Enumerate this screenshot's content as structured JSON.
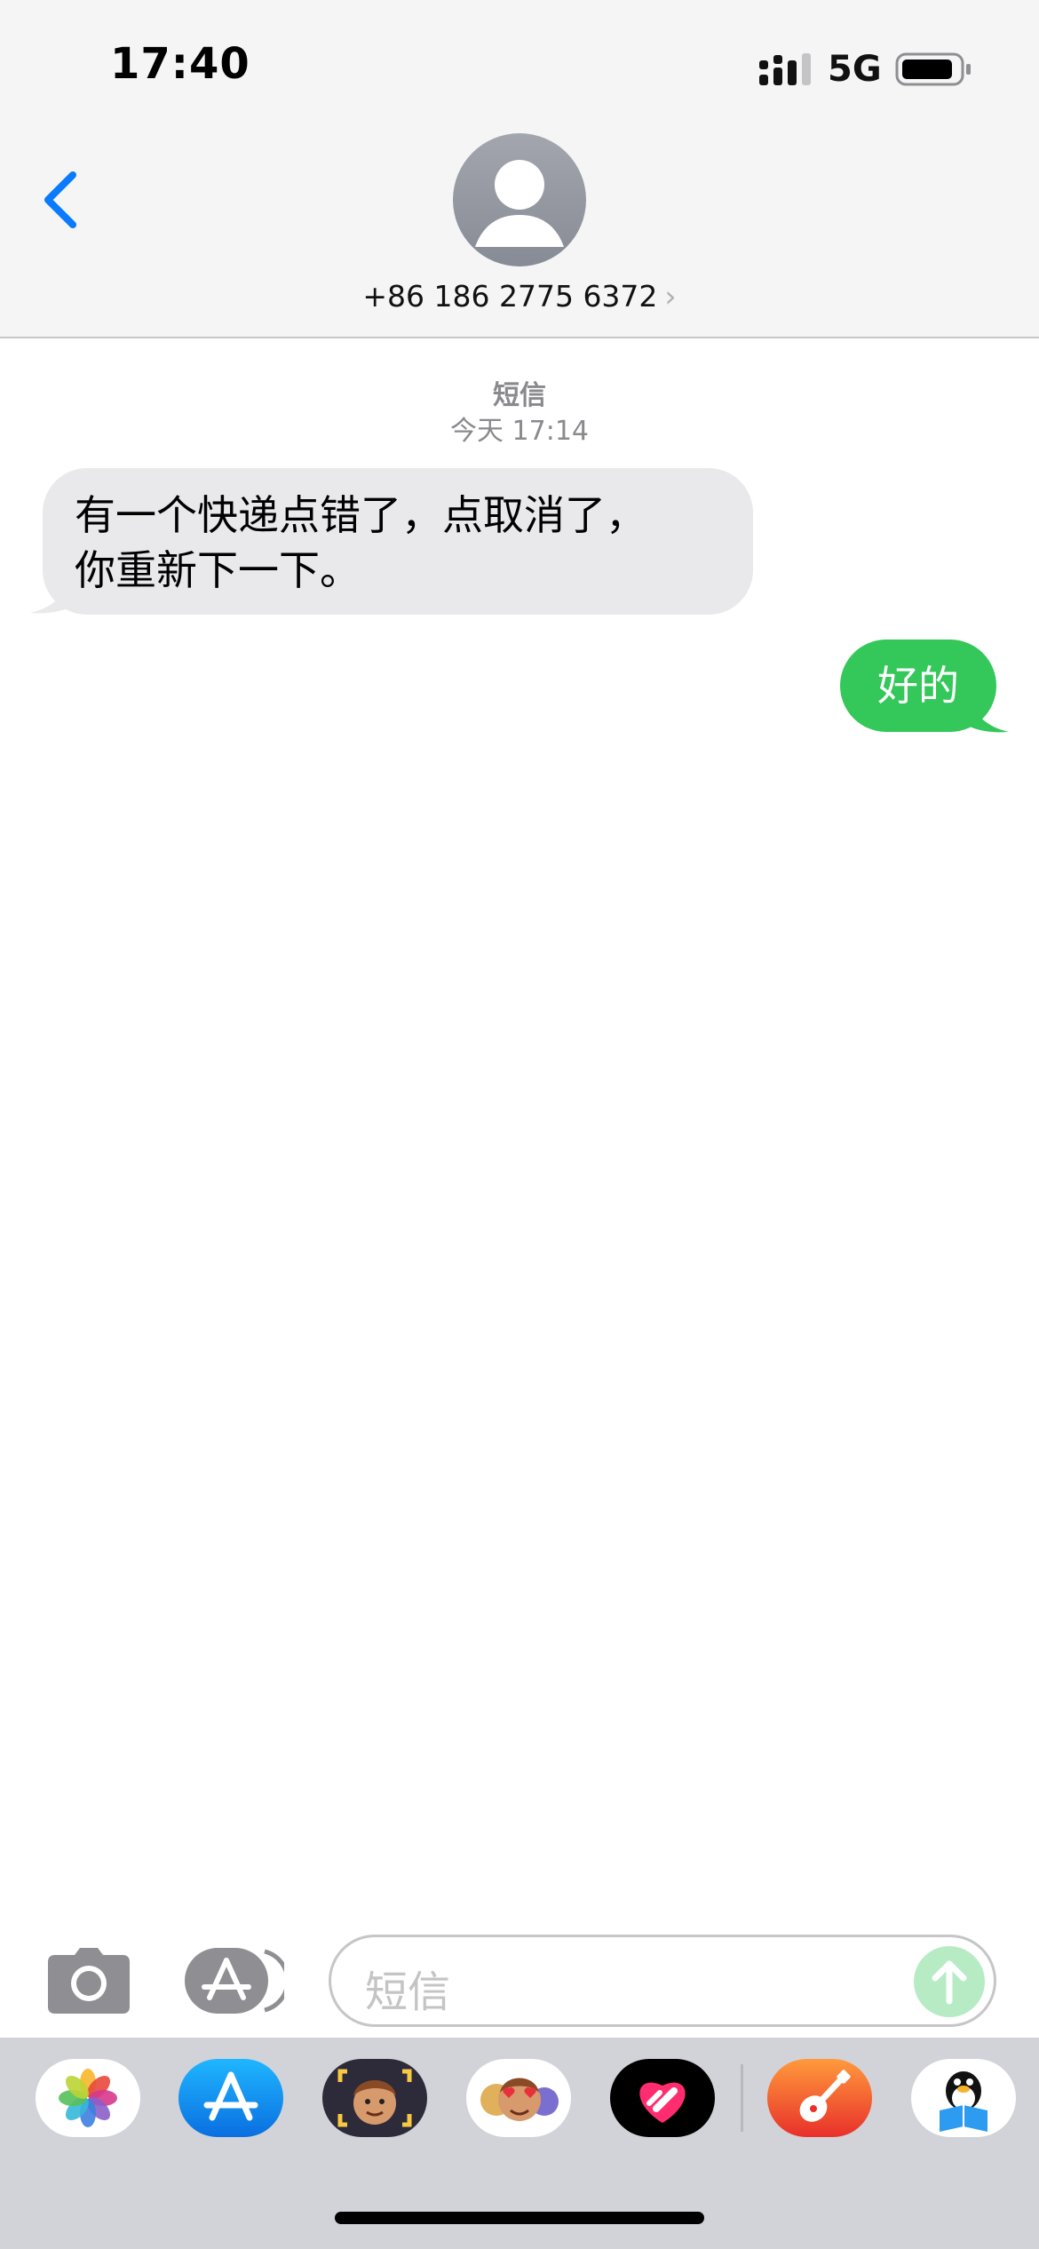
{
  "status_bar": {
    "time": "17:40",
    "network": "5G",
    "icons": [
      "cellular-signal-icon",
      "battery-icon"
    ]
  },
  "header": {
    "back_icon": "chevron-left-icon",
    "avatar_icon": "person-silhouette-icon",
    "contact_label": "+86 186 2775 6372",
    "contact_chevron": "›"
  },
  "conversation": {
    "service_label": "短信",
    "timestamp": "今天 17:14",
    "messages": [
      {
        "direction": "incoming",
        "line1": "有一个快递点错了，点取消了，",
        "line2": "你重新下一下。"
      },
      {
        "direction": "outgoing",
        "text": "好的"
      }
    ]
  },
  "input_bar": {
    "placeholder": "短信",
    "camera_icon": "camera-icon",
    "apps_icon": "app-store-icon",
    "send_icon": "arrow-up-icon"
  },
  "app_drawer": {
    "apps": [
      "photos-app-icon",
      "app-store-app-icon",
      "memoji-app-icon",
      "memoji-stickers-app-icon",
      "digital-touch-app-icon",
      "garageband-app-icon",
      "qq-reader-app-icon"
    ]
  },
  "colors": {
    "accent_blue": "#0a7aff",
    "bubble_incoming": "#e9e9eb",
    "bubble_outgoing": "#34c759",
    "header_bg": "#f5f5f5",
    "drawer_bg": "#d1d3d9"
  }
}
